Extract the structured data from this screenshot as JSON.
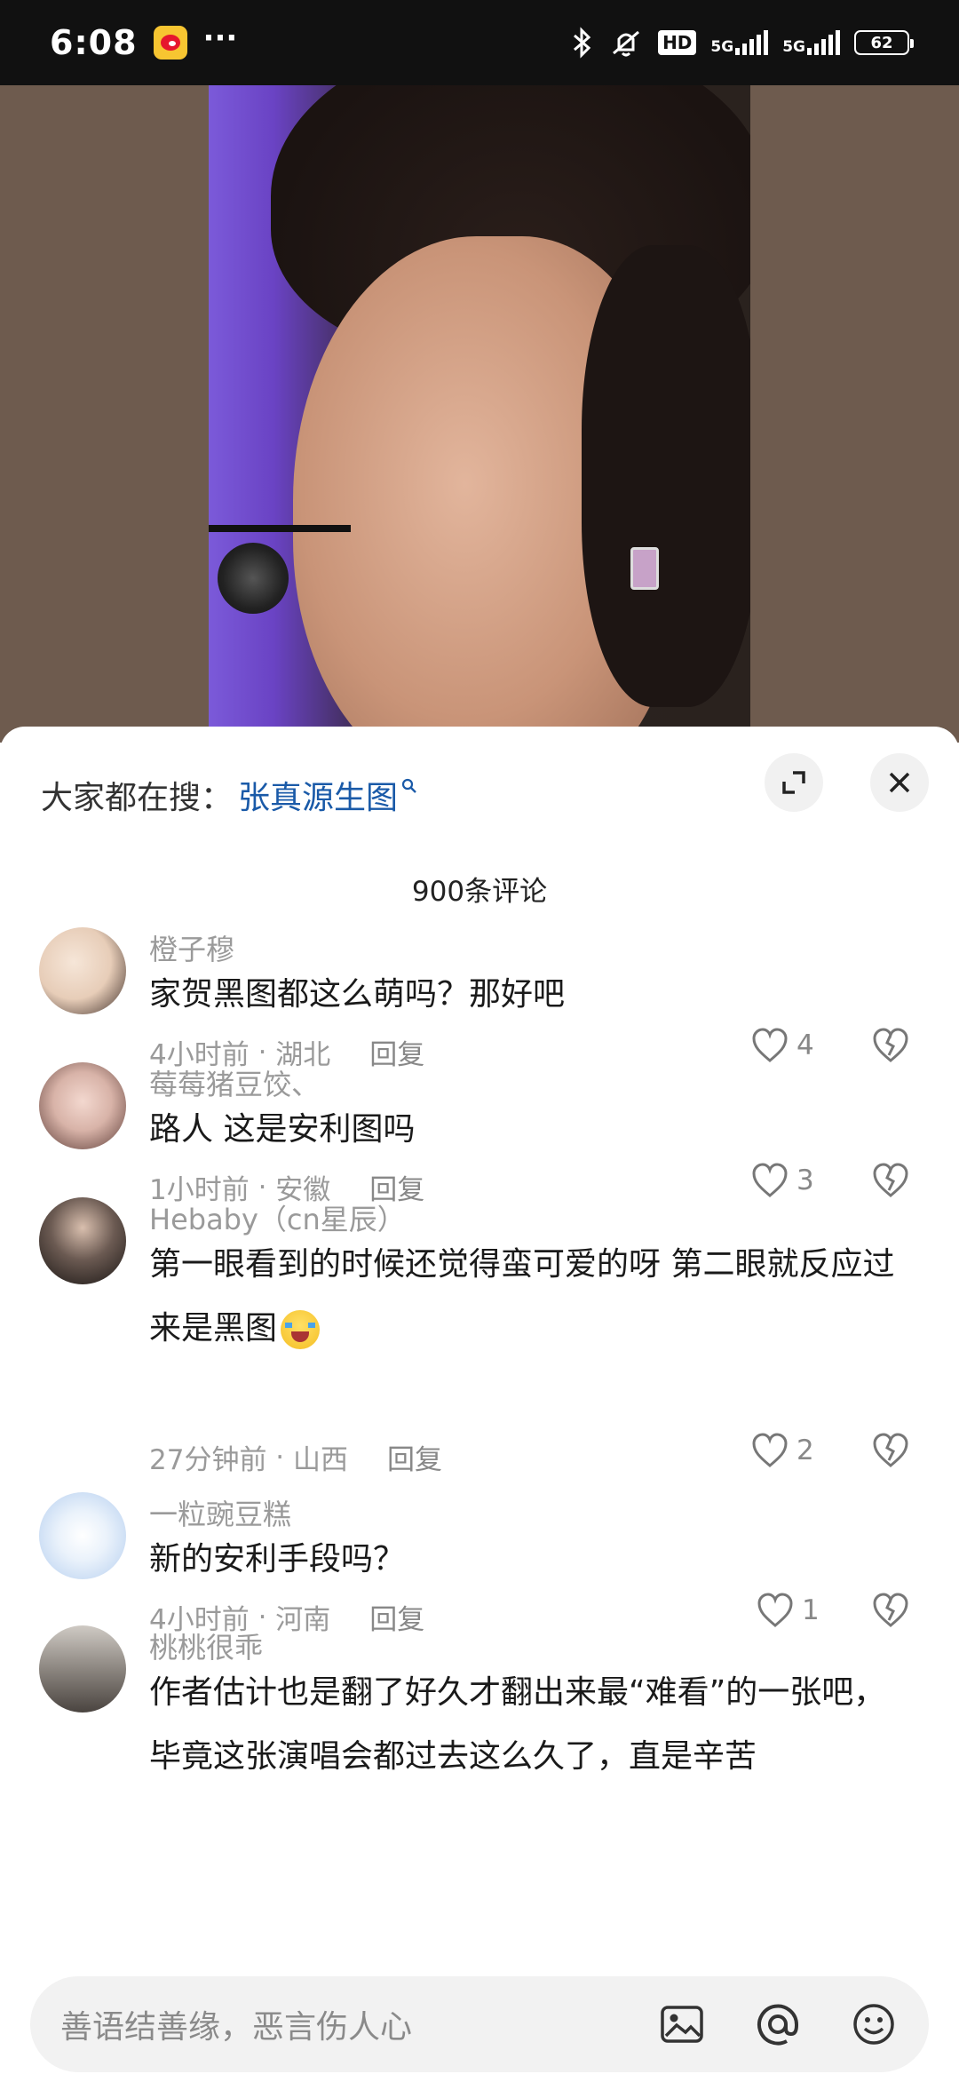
{
  "status_bar": {
    "time": "6:08",
    "more": "···",
    "hd": "HD",
    "net1": "5G",
    "net2": "5G",
    "battery": "62"
  },
  "search": {
    "prefix": "大家都在搜：",
    "keyword": "张真源生图"
  },
  "comments_header": "900条评论",
  "comments": [
    {
      "user": "橙子穆",
      "text": "家贺黑图都这么萌吗？那好吧",
      "time": "4小时前",
      "location": "湖北",
      "reply": "回复",
      "likes": "4"
    },
    {
      "user": "莓莓猪豆饺、",
      "text": "路人 这是安利图吗",
      "time": "1小时前",
      "location": "安徽",
      "reply": "回复",
      "likes": "3"
    },
    {
      "user": "Hebaby（cn星辰）",
      "text": "第一眼看到的时候还觉得蛮可爱的呀 第二眼就反应过来是黑图",
      "time": "27分钟前",
      "location": "山西",
      "reply": "回复",
      "likes": "2"
    },
    {
      "user": "一粒豌豆糕",
      "text": "新的安利手段吗？",
      "time": "4小时前",
      "location": "河南",
      "reply": "回复",
      "likes": "1"
    },
    {
      "user": "桃桃很乖",
      "text": "作者估计也是翻了好久才翻出来最“难看”的一张吧，毕竟这张演唱会都过去这么久了，直是辛苦"
    }
  ],
  "input": {
    "placeholder": "善语结善缘，恶言伤人心"
  },
  "colors": {
    "accent_link": "#1a5aa8",
    "meta_gray": "#9a9a9a"
  },
  "icons": [
    "weibo-app-icon",
    "bluetooth-icon",
    "mute-icon",
    "signal-icon",
    "battery-icon",
    "search-icon",
    "expand-icon",
    "close-icon",
    "heart-icon",
    "broken-heart-icon",
    "image-icon",
    "at-icon",
    "emoji-icon"
  ]
}
